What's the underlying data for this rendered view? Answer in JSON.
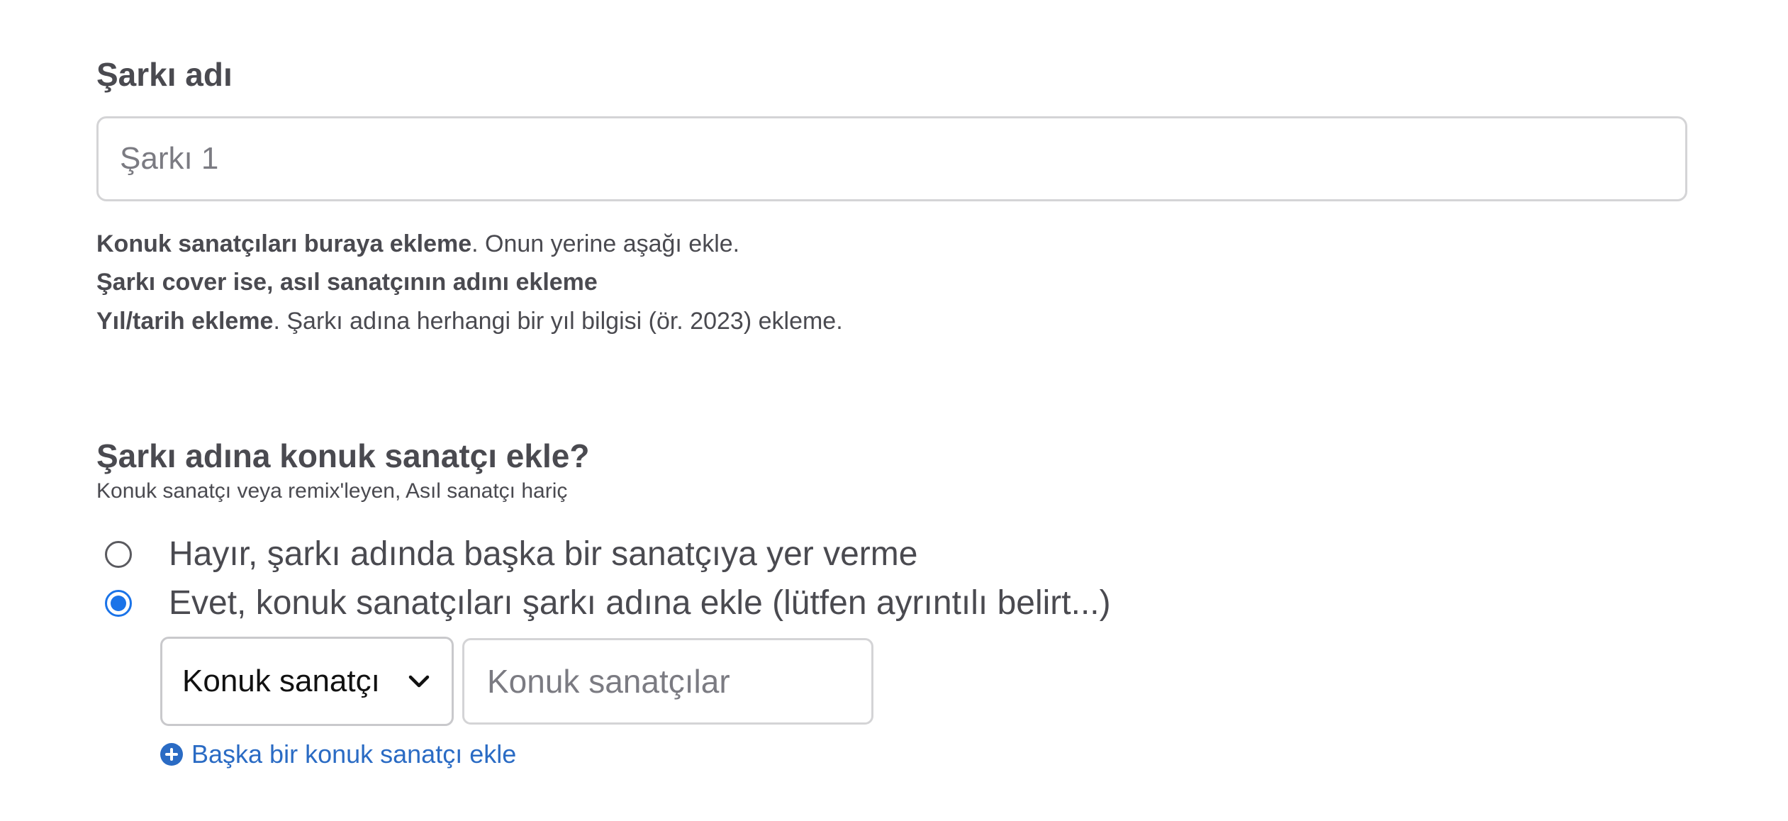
{
  "title_field": {
    "label": "Şarkı adı",
    "placeholder": "Şarkı 1",
    "value": ""
  },
  "hints": [
    {
      "bold": "Konuk sanatçıları buraya ekleme",
      "rest": ". Onun yerine aşağı ekle."
    },
    {
      "bold": "Şarkı cover ise, asıl sanatçının adını ekleme",
      "rest": ""
    },
    {
      "bold": "Yıl/tarih ekleme",
      "rest": ". Şarkı adına herhangi bir yıl bilgisi (ör. 2023) ekleme."
    }
  ],
  "featured": {
    "label": "Şarkı adına konuk sanatçı ekle?",
    "subtitle": "Konuk sanatçı veya remix'leyen, Asıl sanatçı hariç",
    "options": [
      {
        "label": "Hayır, şarkı adında başka bir sanatçıya yer verme",
        "selected": false
      },
      {
        "label": "Evet, konuk sanatçıları şarkı adına ekle (lütfen ayrıntılı belirt...)",
        "selected": true
      }
    ],
    "role_select": {
      "value": "Konuk sanatçı",
      "icon": "chevron-down-icon"
    },
    "artist_input": {
      "placeholder": "Konuk sanatçılar",
      "value": ""
    },
    "add_link": {
      "label": "Başka bir konuk sanatçı ekle",
      "icon": "plus-circle-icon"
    }
  },
  "colors": {
    "accent": "#1a73e8",
    "link": "#2a6bc4",
    "text": "#4a4a50",
    "border": "#d4d4d6"
  }
}
